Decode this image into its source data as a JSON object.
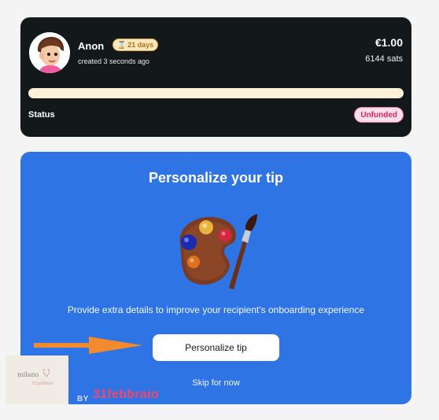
{
  "tip_card": {
    "user_name": "Anon",
    "days_badge": "21 days",
    "created": "created 3 seconds ago",
    "amount": "€1.00",
    "sats": "6144 sats",
    "progress_fraction": 0,
    "status_label": "Status",
    "status_badge": "Unfunded",
    "icons": {
      "avatar": "avatar-cartoon",
      "badge": "hourglass-icon"
    }
  },
  "personalize_card": {
    "title": "Personalize your tip",
    "description": "Provide extra details to improve your recipient's onboarding experience",
    "button_label": "Personalize tip",
    "skip_label": "Skip for now",
    "illustration": "paint-palette-icon"
  },
  "overlay": {
    "logo_line1": "milano",
    "logo_line2": "trustless",
    "by_label": "BY",
    "brand": "31febbraio"
  },
  "colors": {
    "card_dark": "#13191b",
    "card_blue": "#2f74e4",
    "progress_track": "#fdf1d8",
    "status_badge": "#e0245e",
    "arrow": "#f28a2e",
    "brand": "#f0476d"
  }
}
